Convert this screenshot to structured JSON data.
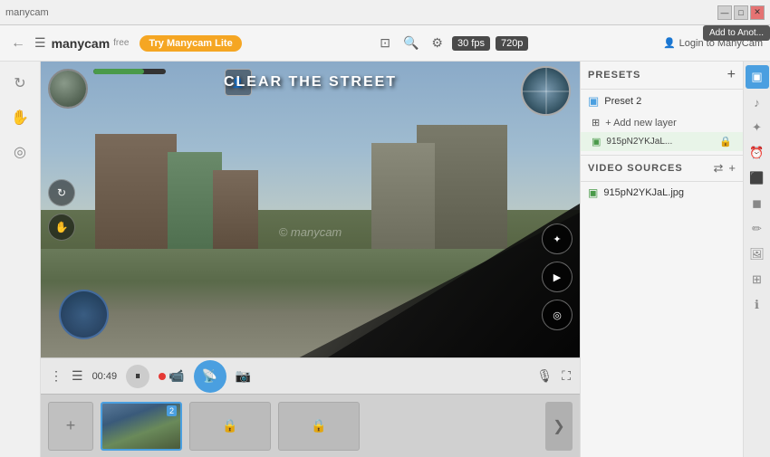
{
  "titlebar": {
    "controls": [
      "minimize",
      "maximize",
      "close"
    ],
    "tooltip": "Add to Anot..."
  },
  "toolbar": {
    "logo": "manycam",
    "free_label": "free",
    "try_button": "Try Manycam Lite",
    "fps": "30 fps",
    "resolution": "720p",
    "login_label": "Login to ManyCam"
  },
  "video": {
    "mission_text": "Clear the Street",
    "watermark": "© manycam",
    "time": "00:49"
  },
  "presets": {
    "label": "PRESETS",
    "add_label": "+",
    "items": [
      {
        "name": "Preset 2",
        "icon": "▣"
      }
    ],
    "add_layer_label": "+ Add new layer",
    "layer_name": "915pN2YKJaL...",
    "lock_icon": "🔒"
  },
  "video_sources": {
    "label": "VIDEO SOURCES",
    "items": [
      {
        "name": "915pN2YKJaL.jpg"
      }
    ]
  },
  "layers_strip": {
    "add_icon": "+",
    "layer_num": "2",
    "lock_icon": "🔒",
    "next_icon": "❯"
  },
  "right_icons": [
    {
      "name": "layers-icon",
      "symbol": "▣",
      "active": true
    },
    {
      "name": "audio-icon",
      "symbol": "♪",
      "active": false
    },
    {
      "name": "effects-icon",
      "symbol": "✦",
      "active": false
    },
    {
      "name": "clock-icon",
      "symbol": "⏰",
      "active": false
    },
    {
      "name": "screen-icon",
      "symbol": "⬛",
      "active": false
    },
    {
      "name": "camera-icon",
      "symbol": "◼",
      "active": false
    },
    {
      "name": "brush-icon",
      "symbol": "✏",
      "active": false
    },
    {
      "name": "image-icon",
      "symbol": "🖼",
      "active": false
    },
    {
      "name": "grid-icon",
      "symbol": "⊞",
      "active": false
    },
    {
      "name": "info-icon",
      "symbol": "ℹ",
      "active": false
    }
  ],
  "left_icons": [
    {
      "name": "rotate-icon",
      "symbol": "↻"
    },
    {
      "name": "hand-icon",
      "symbol": "✋"
    },
    {
      "name": "circle-icon",
      "symbol": "◎"
    }
  ],
  "bottom_toolbar": {
    "menu_icon": "⋮",
    "list_icon": "☰",
    "time": "00:49",
    "pause_icon": "⏸",
    "record_icon": "▶",
    "broadcast_icon": "📡",
    "camera_icon": "📷",
    "mic_icon": "🎙",
    "fullscreen_icon": "⛶"
  }
}
